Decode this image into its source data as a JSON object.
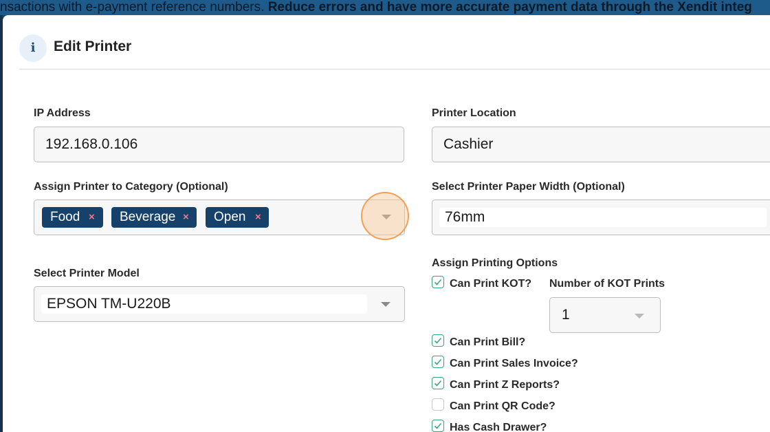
{
  "banner": {
    "text_prefix": "nsactions with e-payment reference numbers. ",
    "text_bold": "Reduce errors and have more accurate payment data through the Xendit integ"
  },
  "modal": {
    "title": "Edit Printer",
    "info_icon_glyph": "i"
  },
  "fields": {
    "ip_address": {
      "label": "IP Address",
      "value": "192.168.0.106"
    },
    "printer_location": {
      "label": "Printer Location",
      "value": "Cashier"
    },
    "category": {
      "label": "Assign Printer to Category (Optional)",
      "tags": [
        {
          "label": "Food",
          "remove": "×"
        },
        {
          "label": "Beverage",
          "remove": "×"
        },
        {
          "label": "Open",
          "remove": "×"
        }
      ]
    },
    "paper_width": {
      "label": "Select Printer Paper Width (Optional)",
      "value": "76mm"
    },
    "printer_model": {
      "label": "Select Printer Model",
      "value": "EPSON TM-U220B"
    }
  },
  "printing_options": {
    "label": "Assign Printing Options",
    "kot_prints": {
      "label": "Number of KOT Prints",
      "value": "1"
    },
    "options": [
      {
        "label": "Can Print KOT?",
        "checked": true
      },
      {
        "label": "Can Print Bill?",
        "checked": true
      },
      {
        "label": "Can Print Sales Invoice?",
        "checked": true
      },
      {
        "label": "Can Print Z Reports?",
        "checked": true
      },
      {
        "label": "Can Print QR Code?",
        "checked": false
      },
      {
        "label": "Has Cash Drawer?",
        "checked": true
      }
    ]
  },
  "colors": {
    "tag_bg": "#16416b",
    "check_green": "#3aa77a",
    "highlight_orange": "#f0a057"
  }
}
